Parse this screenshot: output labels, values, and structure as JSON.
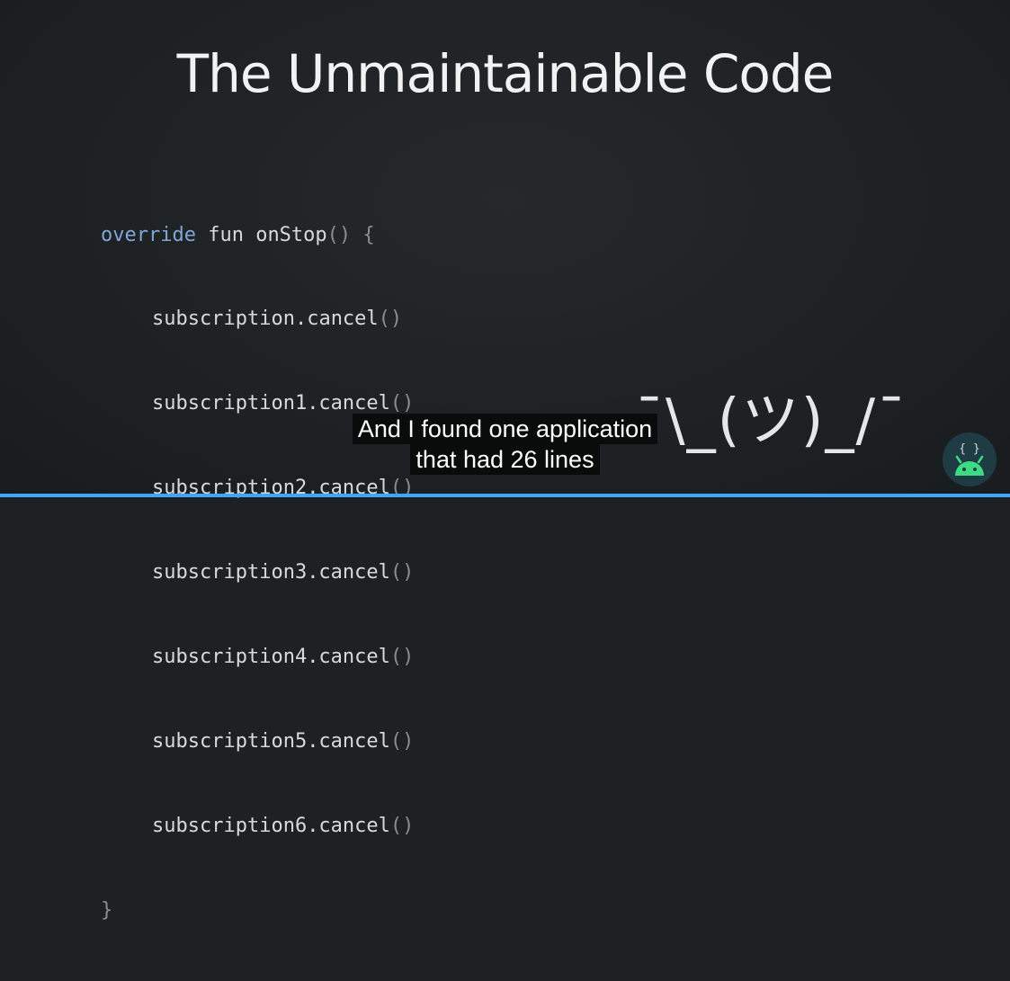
{
  "slide": {
    "title": "The Unmaintainable Code",
    "code": {
      "line0": {
        "kw": "override",
        "rest": " fun onStop",
        "parens": "()",
        "brace": " {"
      },
      "calls": [
        {
          "name": "subscription",
          "method": ".cancel",
          "parens": "()"
        },
        {
          "name": "subscription1",
          "method": ".cancel",
          "parens": "()"
        },
        {
          "name": "subscription2",
          "method": ".cancel",
          "parens": "()"
        },
        {
          "name": "subscription3",
          "method": ".cancel",
          "parens": "()"
        },
        {
          "name": "subscription4",
          "method": ".cancel",
          "parens": "()"
        },
        {
          "name": "subscription5",
          "method": ".cancel",
          "parens": "()"
        },
        {
          "name": "subscription6",
          "method": ".cancel",
          "parens": "()"
        }
      ],
      "closing": "}"
    },
    "shrug": "¯\\_(ツ)_/¯"
  },
  "captions": {
    "line1": "And I found one application",
    "line2": "that had 26 lines"
  },
  "logo": {
    "icon": "android-code-logo-icon",
    "braces": "{ }"
  },
  "player": {
    "progress_fraction": 1.0
  },
  "colors": {
    "background": "#1e2123",
    "keyword": "#7fa6d6",
    "caption_bg": "#080808",
    "android_green": "#3ddc84",
    "progress": "#3ea6ff"
  }
}
